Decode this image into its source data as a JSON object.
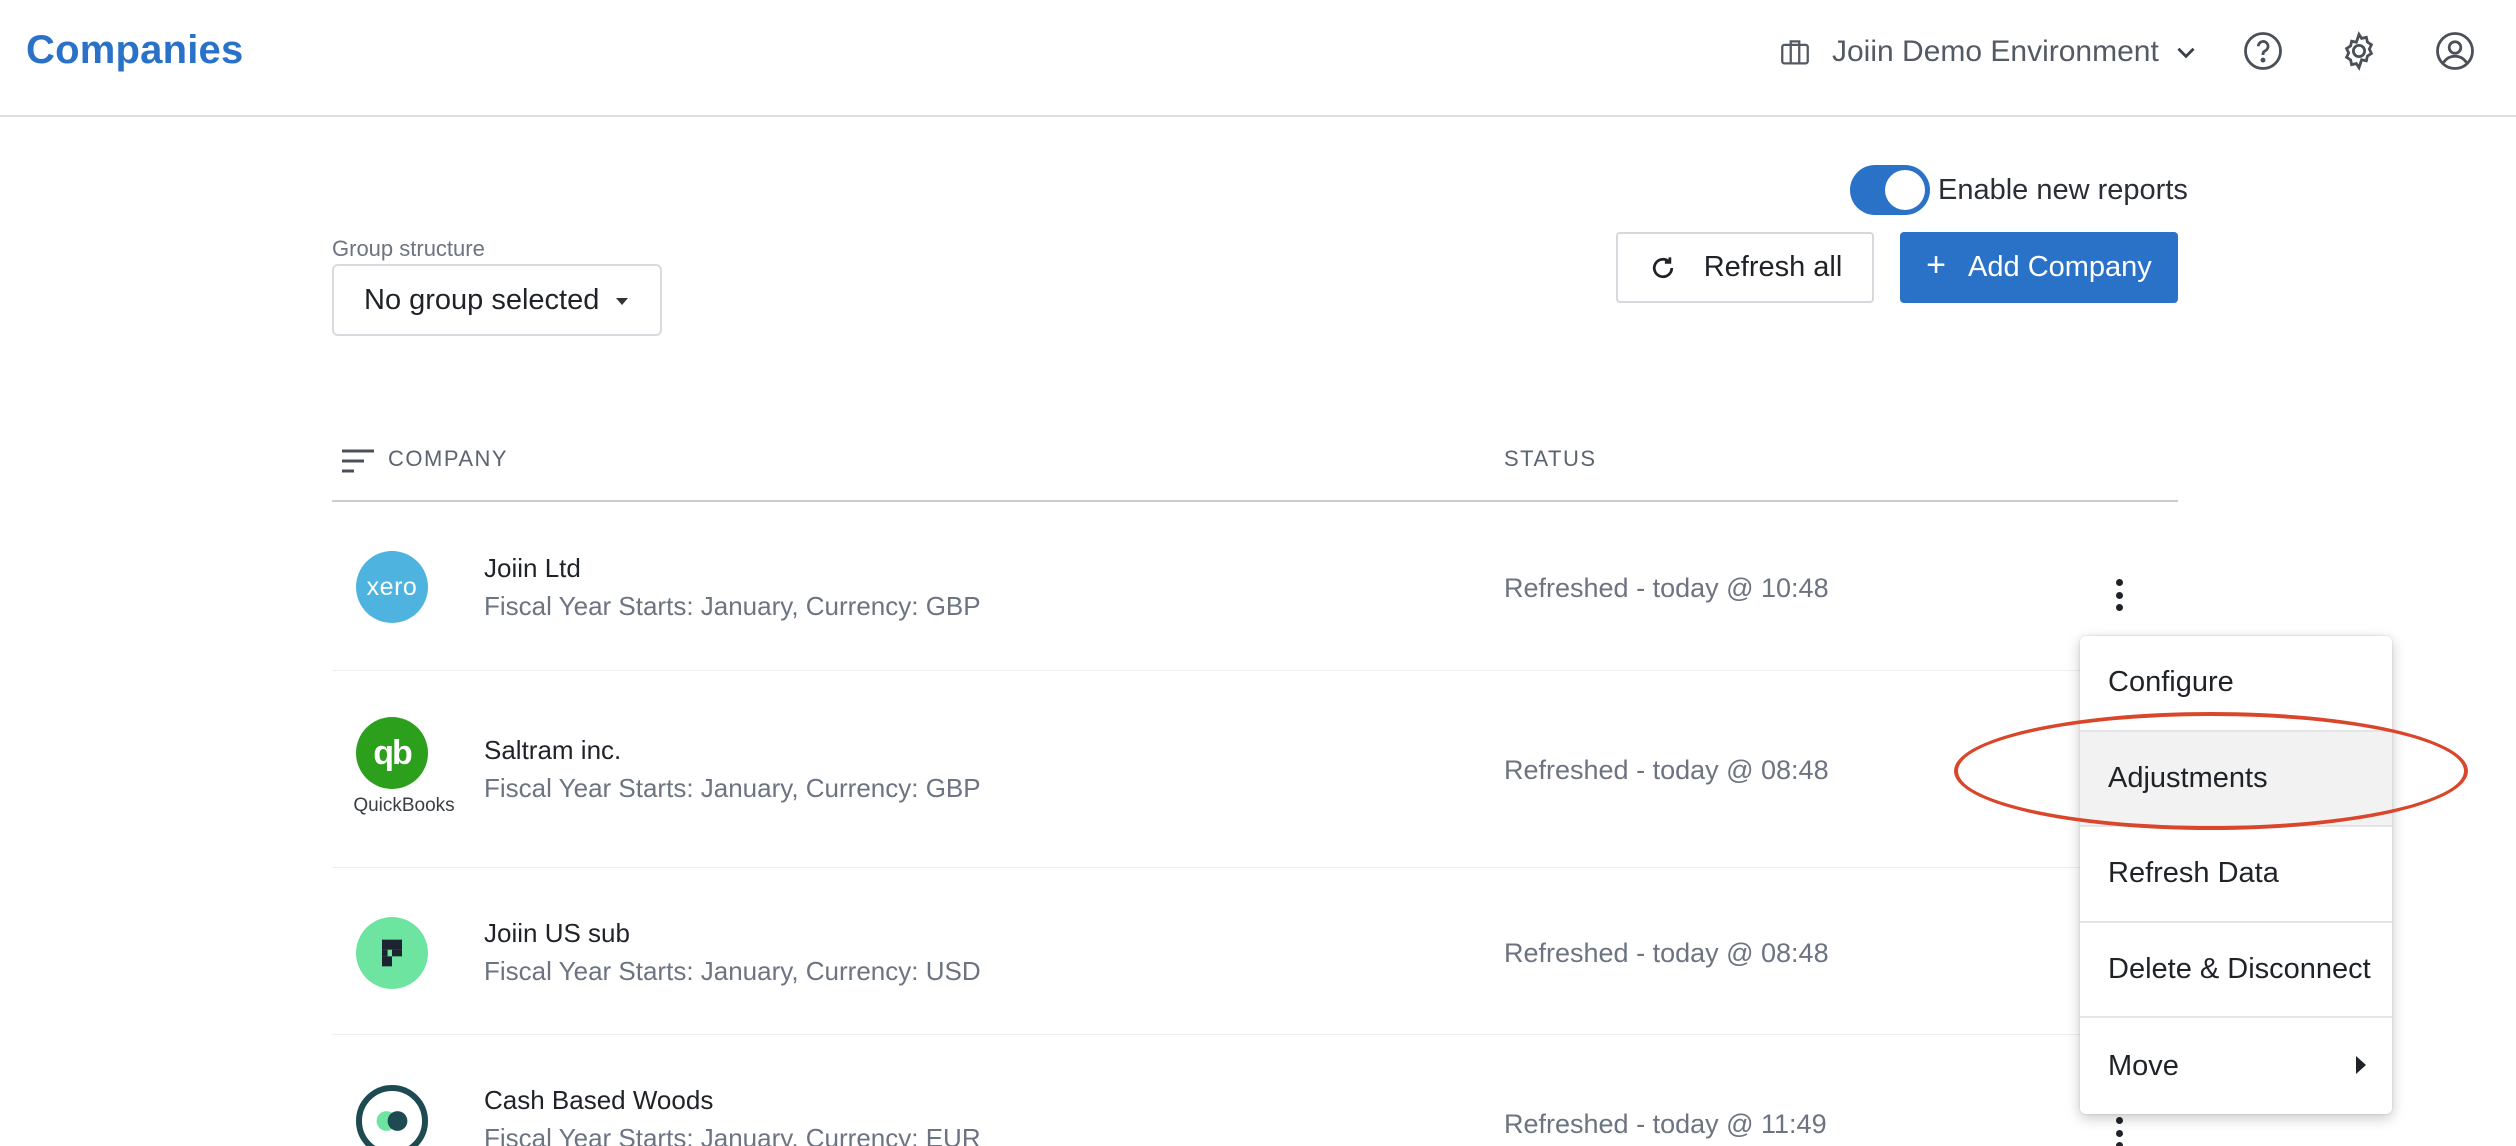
{
  "header": {
    "title": "Companies",
    "environment": "Joiin Demo Environment",
    "icons": [
      "help-icon",
      "settings-icon",
      "account-icon"
    ]
  },
  "toolbar": {
    "toggle_label": "Enable new reports",
    "toggle_on": true,
    "group_label": "Group structure",
    "group_value": "No group selected",
    "refresh_label": "Refresh all",
    "add_label": "Add Company",
    "add_plus": "+"
  },
  "table": {
    "columns": {
      "company": "COMPANY",
      "status": "STATUS"
    },
    "rows": [
      {
        "name": "Joiin Ltd",
        "meta": "Fiscal Year Starts: January, Currency: GBP",
        "status": "Refreshed - today @ 10:48",
        "logo": "xero-logo",
        "logo_text": "xero",
        "caption": ""
      },
      {
        "name": "Saltram inc.",
        "meta": "Fiscal Year Starts: January, Currency: GBP",
        "status": "Refreshed - today @ 08:48",
        "logo": "quickbooks-logo",
        "logo_text": "qb",
        "caption": "QuickBooks"
      },
      {
        "name": "Joiin US sub",
        "meta": "Fiscal Year Starts: January, Currency: USD",
        "status": "Refreshed - today @ 08:48",
        "logo": "green-app-logo",
        "logo_text": "",
        "caption": ""
      },
      {
        "name": "Cash Based Woods",
        "meta": "Fiscal Year Starts: January, Currency: EUR",
        "status": "Refreshed - today @ 11:49",
        "logo": "ring-logo",
        "logo_text": "",
        "caption": ""
      }
    ]
  },
  "context_menu": {
    "items": [
      "Configure",
      "Adjustments",
      "Refresh Data",
      "Delete & Disconnect",
      "Move"
    ],
    "highlighted": "Adjustments"
  },
  "colors": {
    "accent": "#2a72c8",
    "annotation": "#d9462b",
    "xero": "#4fb3e0",
    "quickbooks": "#2ca01c",
    "green_app": "#6ee4a1",
    "ring": "#1e4a52"
  }
}
